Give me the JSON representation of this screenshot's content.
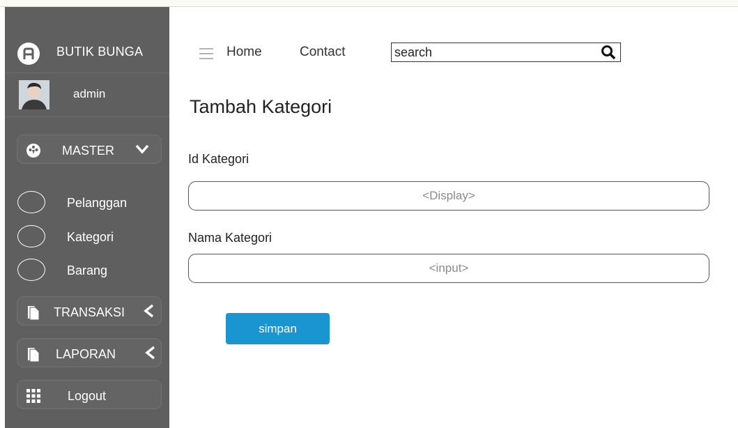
{
  "sidebar": {
    "brand": {
      "name": "BUTIK BUNGA",
      "logo_icon": "store-logo-icon"
    },
    "user": {
      "name": "admin",
      "avatar_icon": "user-avatar"
    },
    "menu": {
      "master": {
        "label": "MASTER",
        "icon": "dashboard-gauge-icon",
        "chevron": "chevron-down-icon"
      },
      "sub_items": [
        {
          "label": "Pelanggan"
        },
        {
          "label": "Kategori"
        },
        {
          "label": "Barang"
        }
      ],
      "transaksi": {
        "label": "TRANSAKSI",
        "icon": "document-icon",
        "chevron": "chevron-left-icon"
      },
      "laporan": {
        "label": "LAPORAN",
        "icon": "document-icon",
        "chevron": "chevron-left-icon"
      },
      "logout": {
        "label": "Logout",
        "icon": "grid-icon"
      }
    }
  },
  "header": {
    "nav": {
      "home": "Home",
      "contact": "Contact"
    },
    "search": {
      "value": "search",
      "icon": "search-icon"
    }
  },
  "main": {
    "title": "Tambah Kategori",
    "fields": [
      {
        "label": "Id Kategori",
        "value": "<Display>"
      },
      {
        "label": "Nama Kategori",
        "value": "<input>"
      }
    ],
    "save_label": "simpan"
  },
  "colors": {
    "sidebar_bg": "#5f5f5f",
    "button_bg": "#1996d1"
  }
}
